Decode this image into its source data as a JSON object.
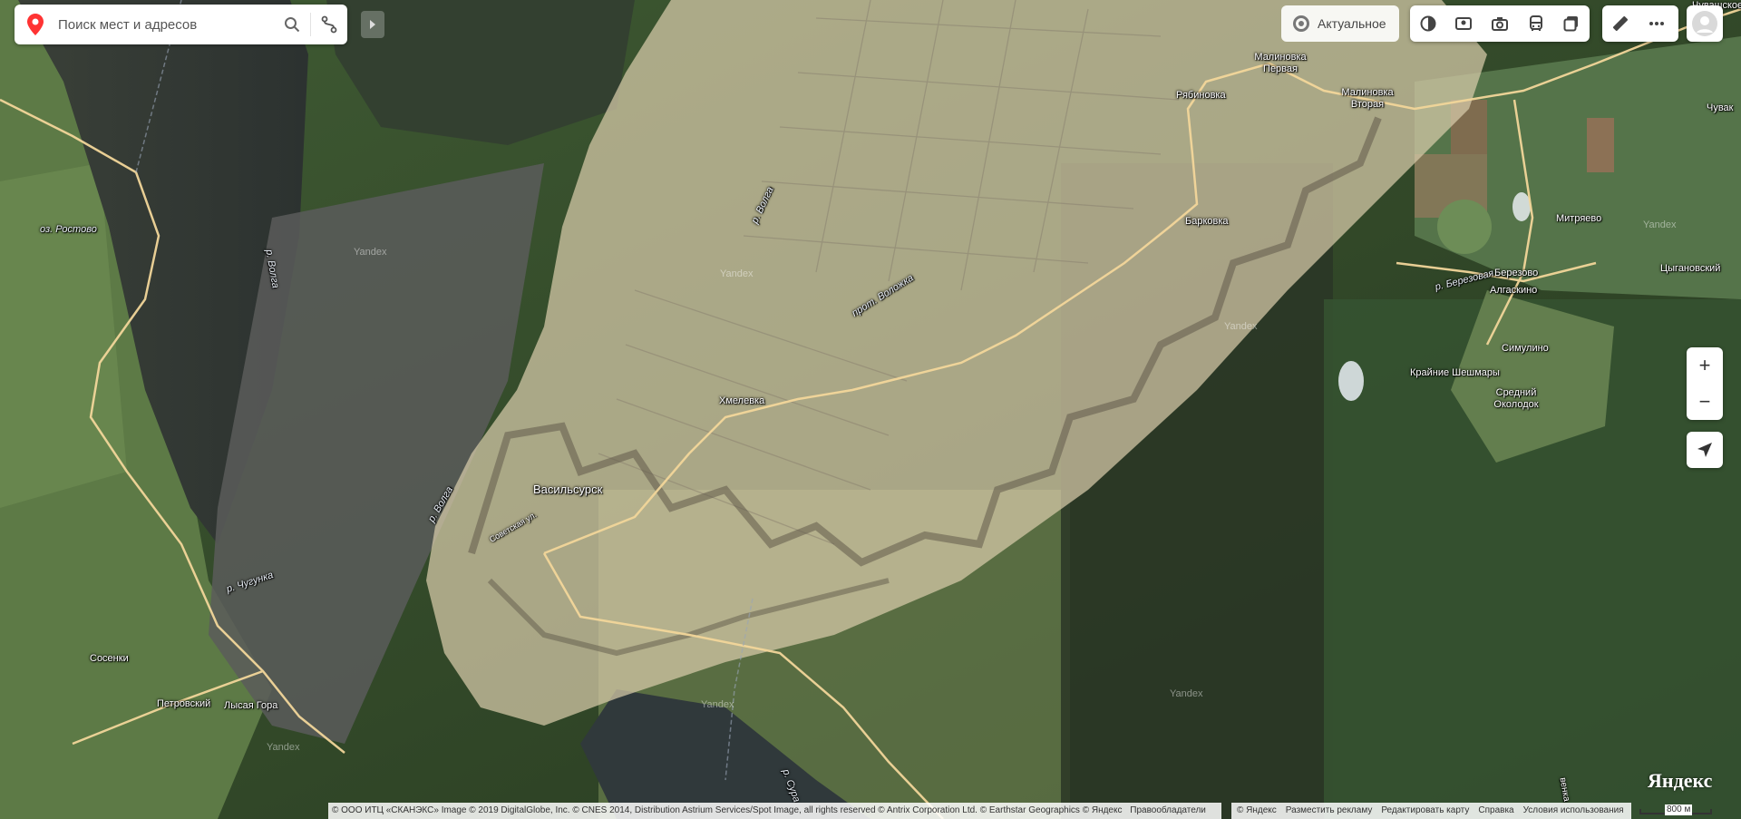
{
  "search": {
    "placeholder": "Поиск мест и адресов"
  },
  "layers": {
    "actual_label": "Актуальное"
  },
  "zoom": {
    "plus": "+",
    "minus": "−"
  },
  "brand": "Яндекс",
  "labels": {
    "vasilsursk": "Васильсурск",
    "hmelevka": "Хмелевка",
    "barkovka": "Барковка",
    "ryabinovka": "Рябиновка",
    "malinovka_1_a": "Малиновка",
    "malinovka_1_b": "Первая",
    "malinovka_2_a": "Малиновка",
    "malinovka_2_b": "Вторая",
    "mitryaevo": "Митряево",
    "berezovo": "Березово",
    "algaskino": "Алгаскино",
    "tsyganovsky": "Цыгановский",
    "simulino": "Симулино",
    "krainie": "Крайние Шешмары",
    "sredny_a": "Средний",
    "sredny_b": "Околодок",
    "chuvak": "Чувак",
    "chuvak_top": "Чувашское Трет",
    "sosenki": "Сосенки",
    "petrovsky": "Петровский",
    "lysaya": "Лысая Гора",
    "lake_rostovo": "оз. Ростово",
    "river_volga_1": "р. Волга",
    "river_volga_2": "р. Волга",
    "river_volga_3": "р. Волга",
    "river_chugunka": "р. Чугунка",
    "river_berezovaya": "р. Березовая",
    "river_sura": "р. Сура",
    "prot_volozhka": "прот. Воложка",
    "sovetskaya": "Советская ул.",
    "veska": "венка",
    "watermark": "Yandex"
  },
  "copyright": [
    "© ООО ИТЦ «СКАНЭКС» Image © 2019 DigitalGlobe, Inc. © CNES 2014, Distribution Astrium Services/Spot Image, all rights reserved © Antrix Corporation Ltd. © Earthstar Geographics © Яндекс",
    "Правообладатели"
  ],
  "footer_links": [
    "© Яндекс",
    "Разместить рекламу",
    "Редактировать карту",
    "Справка",
    "Условия использования"
  ],
  "scale": "800 м",
  "colors": {
    "accent_red": "#ff3333",
    "overlay": "#d8ccaa",
    "road": "#f2d69a"
  }
}
